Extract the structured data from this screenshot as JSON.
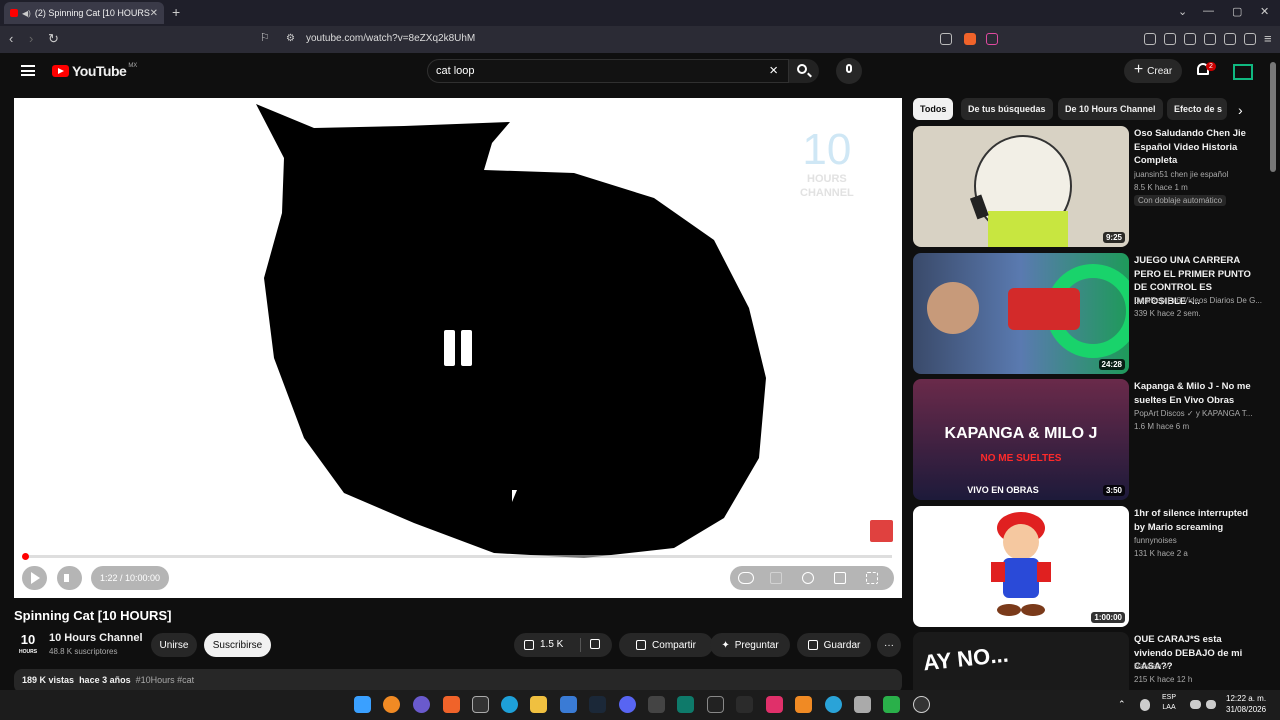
{
  "browser": {
    "tab_title": "(2) Spinning Cat [10 HOURS]",
    "url": "youtube.com/watch?v=8eZXq2k8UhM"
  },
  "header": {
    "logo_text": "YouTube",
    "country_code": "MX",
    "search_value": "cat loop",
    "create_label": "Crear",
    "notifications_count": "2"
  },
  "player": {
    "watermark_number": "10",
    "watermark_text_1": "HOURS",
    "watermark_text_2": "CHANNEL",
    "time_display": "1:22 / 10:00:00",
    "progress_fraction": 0.0023
  },
  "video": {
    "title": "Spinning Cat [10 HOURS]",
    "channel_logo_number": "10",
    "channel_logo_sub": "HOURS",
    "channel_name": "10 Hours Channel",
    "subscribers": "48.8 K suscriptores",
    "join_label": "Unirse",
    "subscribe_label": "Suscribirse",
    "likes": "1.5 K",
    "share_label": "Compartir",
    "ask_label": "Preguntar",
    "save_label": "Guardar",
    "views": "189 K vistas",
    "age": "hace 3 años",
    "tags": "#10Hours #cat"
  },
  "chips": [
    "Todos",
    "De tus búsquedas",
    "De 10 Hours Channel",
    "Efecto de s"
  ],
  "recommendations": [
    {
      "title": "Oso Saludando Chen Jie Español Video Historia Completa",
      "channel": "juansin51 chen jie español",
      "stats": "8.5 K   hace 1 m",
      "badge": "Con doblaje automático",
      "duration": "9:25",
      "thumb_color": "#d8d2c4"
    },
    {
      "title": "JUEGO UNA CARRERA PERO EL PRIMER PUNTO DE CONTROL ES IMPOSIBLE -...",
      "channel": "DaniRep | +6 Videos Diarios De G...",
      "stats": "339 K   hace 2 sem.",
      "duration": "24:28",
      "thumb_color": "#4b6fa8"
    },
    {
      "title": "Kapanga & Milo J - No me sueltes En Vivo Obras",
      "channel": "PopArt Discos ✓ y KAPANGA T...",
      "stats": "1.6 M   hace 6 m",
      "duration": "3:50",
      "thumb_color": "#2e1a4a",
      "thumb_text_1": "KAPANGA & MILO J",
      "thumb_text_2": "NO ME SUELTES",
      "thumb_text_3": "VIVO EN OBRAS"
    },
    {
      "title": "1hr of silence interrupted by Mario screaming",
      "channel": "funnynoises",
      "stats": "131 K   hace 2 a",
      "duration": "1:00:00",
      "thumb_color": "#ffffff"
    },
    {
      "title": "QUE CARAJ*S esta viviendo DEBAJO de mi CASA??",
      "channel": "Natalan ✓",
      "stats": "215 K   hace 12 h",
      "thumb_color": "#1a1a1a",
      "thumb_text_1": "AY NO..."
    }
  ],
  "taskbar": {
    "lang_1": "ESP",
    "lang_2": "LAA",
    "time": "12:22 a. m.",
    "date": "31/08/2026"
  }
}
